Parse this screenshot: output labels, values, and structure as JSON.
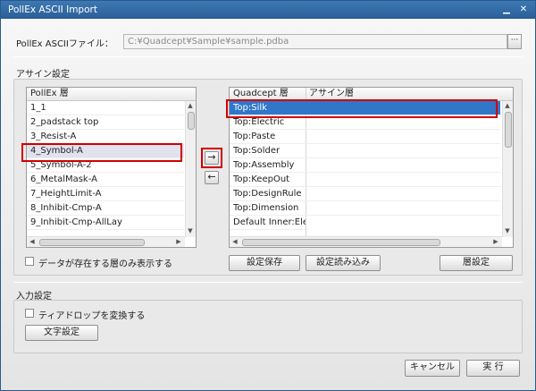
{
  "window": {
    "title": "PollEx ASCII Import",
    "minimize_icon": "minimize-icon",
    "close_icon": "close-icon"
  },
  "file": {
    "label": "PollEx ASCIIファイル：",
    "path": "C:¥Quadcept¥Sample¥sample.pdba",
    "browse_label": "···"
  },
  "assign": {
    "section_label": "アサイン設定",
    "left_header": "PollEx 層",
    "left_items": [
      "1_1",
      "2_padstack top",
      "3_Resist-A",
      "4_Symbol-A",
      "5_Symbol-A-2",
      "6_MetalMask-A",
      "7_HeightLimit-A",
      "8_Inhibit-Cmp-A",
      "9_Inhibit-Cmp-AllLay"
    ],
    "left_selected": "4_Symbol-A",
    "right_headers": [
      "Quadcept 層",
      "アサイン層"
    ],
    "right_items": [
      "Top:Silk",
      "Top:Electric",
      "Top:Paste",
      "Top:Solder",
      "Top:Assembly",
      "Top:KeepOut",
      "Top:DesignRule",
      "Top:Dimension",
      "Default Inner:Ele"
    ],
    "right_selected": "Top:Silk",
    "assign_arrow": "→",
    "remove_arrow": "←",
    "only_data_label": "データが存在する層のみ表示する",
    "save_btn": "設定保存",
    "load_btn": "設定読み込み",
    "layer_btn": "層設定"
  },
  "input": {
    "section_label": "入力設定",
    "tilde_label": "ティアドロップを変換する",
    "text_btn": "文字設定"
  },
  "footer": {
    "cancel": "キャンセル",
    "run": "実 行"
  }
}
